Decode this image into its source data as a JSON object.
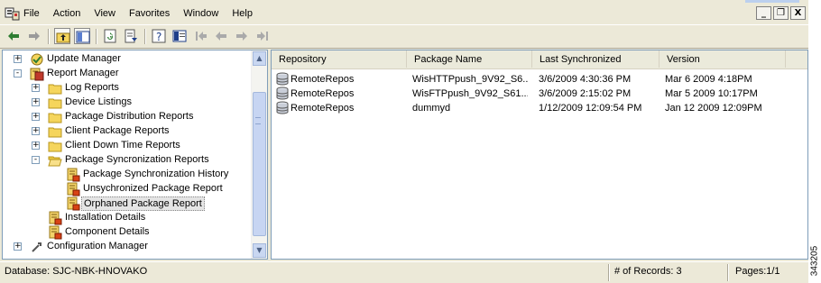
{
  "menu": {
    "items": [
      "File",
      "Action",
      "View",
      "Favorites",
      "Window",
      "Help"
    ]
  },
  "window_controls": {
    "minimize": "_",
    "restore": "❐",
    "close": "X"
  },
  "toolbar": {
    "icons": [
      "back-arrow-icon",
      "forward-arrow-icon",
      "up-folder-icon",
      "show-hide-tree-icon",
      "refresh-icon",
      "export-list-icon",
      "help-icon",
      "console-icon",
      "first-page-icon",
      "previous-page-icon",
      "next-page-icon",
      "last-page-icon"
    ]
  },
  "tree": {
    "items": [
      {
        "label": "Update Manager",
        "level": 0,
        "expander": "+",
        "icon": "update-manager-icon"
      },
      {
        "label": "Report Manager",
        "level": 0,
        "expander": "-",
        "icon": "report-manager-icon"
      },
      {
        "label": "Log Reports",
        "level": 1,
        "expander": "+",
        "icon": "folder-icon"
      },
      {
        "label": "Device Listings",
        "level": 1,
        "expander": "+",
        "icon": "folder-icon"
      },
      {
        "label": "Package Distribution Reports",
        "level": 1,
        "expander": "+",
        "icon": "folder-icon"
      },
      {
        "label": "Client Package Reports",
        "level": 1,
        "expander": "+",
        "icon": "folder-icon"
      },
      {
        "label": "Client Down Time Reports",
        "level": 1,
        "expander": "+",
        "icon": "folder-icon"
      },
      {
        "label": "Package Syncronization Reports",
        "level": 1,
        "expander": "-",
        "icon": "open-folder-icon"
      },
      {
        "label": "Package Synchronization History",
        "level": 2,
        "expander": "",
        "icon": "report-icon"
      },
      {
        "label": "Unsychronized Package Report",
        "level": 2,
        "expander": "",
        "icon": "report-icon"
      },
      {
        "label": "Orphaned Package Report",
        "level": 2,
        "expander": "",
        "icon": "report-icon",
        "selected": true
      },
      {
        "label": "Installation Details",
        "level": 1,
        "expander": "",
        "icon": "report-icon"
      },
      {
        "label": "Component Details",
        "level": 1,
        "expander": "",
        "icon": "report-icon"
      },
      {
        "label": "Configuration Manager",
        "level": 0,
        "expander": "+",
        "icon": "configuration-manager-icon"
      }
    ]
  },
  "list": {
    "columns": [
      "Repository",
      "Package Name",
      "Last Synchronized",
      "Version"
    ],
    "rows": [
      {
        "repository": "RemoteRepos",
        "package": "WisHTTPpush_9V92_S6...",
        "last_sync": "3/6/2009 4:30:36 PM",
        "version": "Mar  6 2009  4:18PM"
      },
      {
        "repository": "RemoteRepos",
        "package": "WisFTPpush_9V92_S61...",
        "last_sync": "3/6/2009 2:15:02 PM",
        "version": "Mar  5 2009 10:17PM"
      },
      {
        "repository": "RemoteRepos",
        "package": "dummyd",
        "last_sync": "1/12/2009 12:09:54 PM",
        "version": "Jan 12 2009 12:09PM"
      }
    ]
  },
  "status": {
    "database": "Database: SJC-NBK-HNOVAKO",
    "records": "# of Records: 3",
    "pages": "Pages:1/1"
  },
  "figure_number": "343205",
  "colors": {
    "pane_border": "#7f9db9",
    "chrome": "#ece9d8",
    "folder": "#f5d55c",
    "scrollbar": "#c7d5f2"
  }
}
